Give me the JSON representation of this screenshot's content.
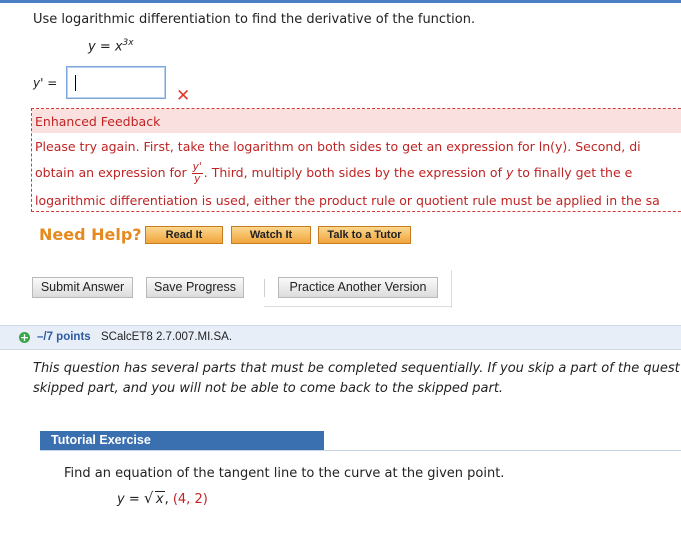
{
  "question": {
    "prompt": "Use logarithmic differentiation to find the derivative of the function.",
    "equation_lhs": "y = x",
    "equation_exp": "3x",
    "answer_label": "y' =",
    "answer_value": ""
  },
  "feedback": {
    "title": "Enhanced Feedback",
    "line1": "Please try again. First, take the logarithm on both sides to get an expression for  ln(y).  Second, di",
    "line2_a": "obtain an expression for ",
    "frac_num": "y'",
    "frac_den": "y",
    "line2_b": ".  Third, multiply both sides by the expression of ",
    "line2_var": "y",
    "line2_c": "  to finally get the e",
    "line3": "logarithmic differentiation is used, either the product rule or quotient rule must be applied in the sa"
  },
  "help": {
    "label": "Need Help?",
    "read": "Read It",
    "watch": "Watch It",
    "tutor": "Talk to a Tutor"
  },
  "actions": {
    "submit": "Submit Answer",
    "save": "Save Progress",
    "practice": "Practice Another Version"
  },
  "next_question": {
    "points": "–/7 points",
    "code": "SCalcET8 2.7.007.MI.SA.",
    "instr1": "This question has several parts that must be completed sequentially. If you skip a part of the quest",
    "instr2": "skipped part, and you will not be able to come back to the skipped part.",
    "tutorial_title": "Tutorial Exercise",
    "task": "Find an equation of the tangent line to the curve at the given point.",
    "eq_lhs": "y = ",
    "eq_rad": "x",
    "eq_sep": ",",
    "eq_point": "(4, 2)"
  },
  "colors": {
    "feedback_red": "#c02323",
    "feedback_bg": "#fbe0e0",
    "help_orange": "#e58a1f",
    "tutorial_blue": "#3a6fb0",
    "points_blue": "#2d5aa0"
  },
  "icons": {
    "wrong": "close-x-icon",
    "expand": "plus-circle-icon"
  }
}
